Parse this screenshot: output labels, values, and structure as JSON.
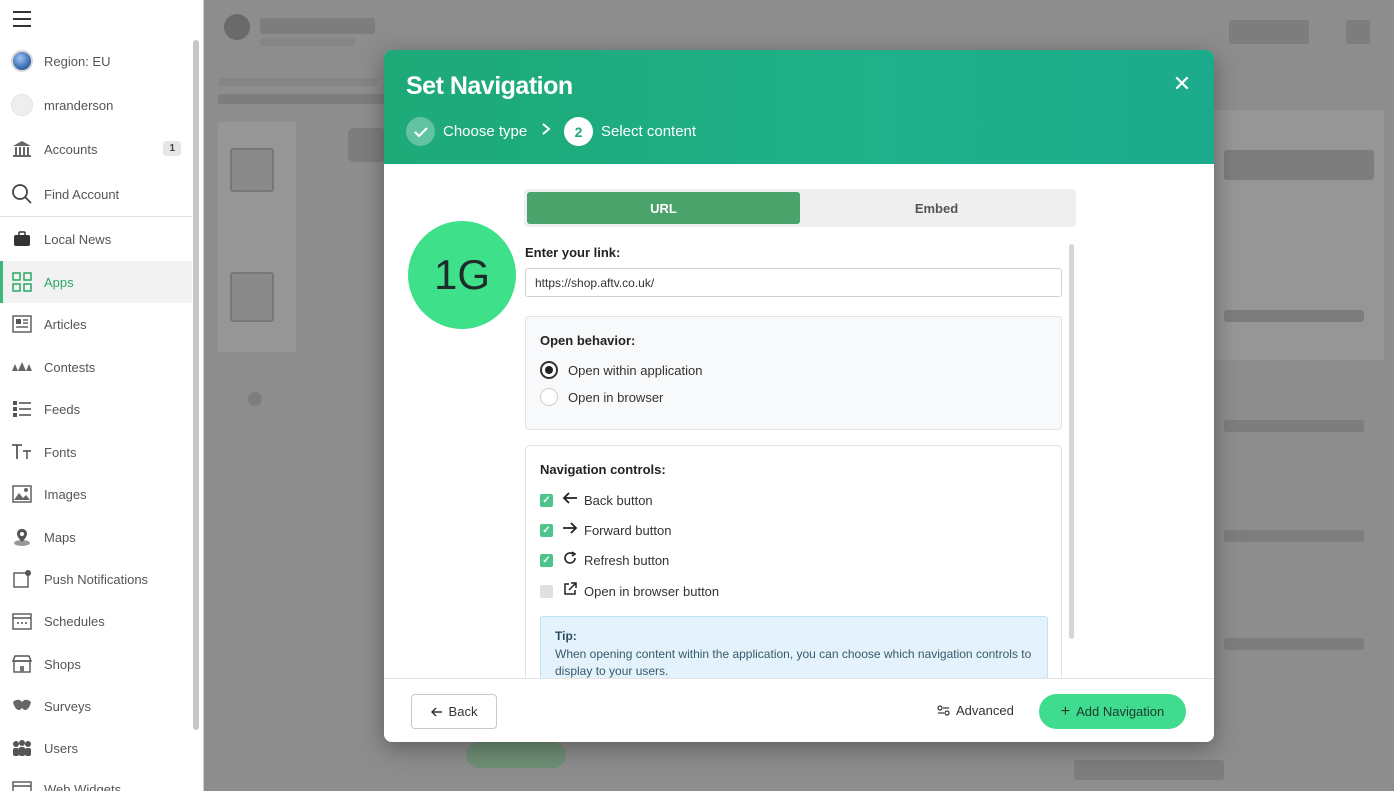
{
  "sidebar": {
    "items": [
      {
        "label": "Region: EU",
        "icon": "globe-icon"
      },
      {
        "label": "mranderson",
        "icon": "user-avatar"
      },
      {
        "label": "Accounts",
        "icon": "bank-icon",
        "badge": "1"
      },
      {
        "label": "Find Account",
        "icon": "search-icon"
      },
      {
        "label": "Local News",
        "icon": "briefcase-icon"
      },
      {
        "label": "Apps",
        "icon": "grid-icon",
        "active": true
      },
      {
        "label": "Articles",
        "icon": "article-icon"
      },
      {
        "label": "Contests",
        "icon": "contests-icon"
      },
      {
        "label": "Feeds",
        "icon": "feeds-icon"
      },
      {
        "label": "Fonts",
        "icon": "fonts-icon"
      },
      {
        "label": "Images",
        "icon": "image-icon"
      },
      {
        "label": "Maps",
        "icon": "map-pin-icon"
      },
      {
        "label": "Push Notifications",
        "icon": "push-notification-icon"
      },
      {
        "label": "Schedules",
        "icon": "calendar-icon"
      },
      {
        "label": "Shops",
        "icon": "shop-icon"
      },
      {
        "label": "Surveys",
        "icon": "survey-icon"
      },
      {
        "label": "Users",
        "icon": "users-icon"
      },
      {
        "label": "Web Widgets",
        "icon": "widget-icon"
      }
    ]
  },
  "modal": {
    "title": "Set Navigation",
    "steps": [
      {
        "label": "Choose type",
        "state": "done"
      },
      {
        "number": "2",
        "label": "Select content",
        "state": "current"
      }
    ],
    "avatar_text": "1G",
    "tabs": [
      {
        "label": "URL",
        "active": true
      },
      {
        "label": "Embed",
        "active": false
      }
    ],
    "link_label": "Enter your link:",
    "link_value": "https://shop.aftv.co.uk/",
    "open_behavior": {
      "title": "Open behavior:",
      "options": [
        {
          "label": "Open within application",
          "selected": true
        },
        {
          "label": "Open in browser",
          "selected": false
        }
      ]
    },
    "nav_controls": {
      "title": "Navigation controls:",
      "items": [
        {
          "label": "Back button",
          "checked": true,
          "icon": "arrow-left-icon"
        },
        {
          "label": "Forward button",
          "checked": true,
          "icon": "arrow-right-icon"
        },
        {
          "label": "Refresh button",
          "checked": true,
          "icon": "refresh-icon"
        },
        {
          "label": "Open in browser button",
          "checked": false,
          "icon": "external-link-icon"
        }
      ]
    },
    "tip": {
      "title": "Tip:",
      "text": "When opening content within the application, you can choose which navigation controls to display to your users."
    },
    "footer": {
      "back_label": "Back",
      "advanced_label": "Advanced",
      "add_label": "Add Navigation"
    }
  },
  "colors": {
    "accent": "#1fae82",
    "primary_button": "#3fdb8e",
    "segment_active": "#4aa36a",
    "avatar_bg": "#3ee08a"
  }
}
